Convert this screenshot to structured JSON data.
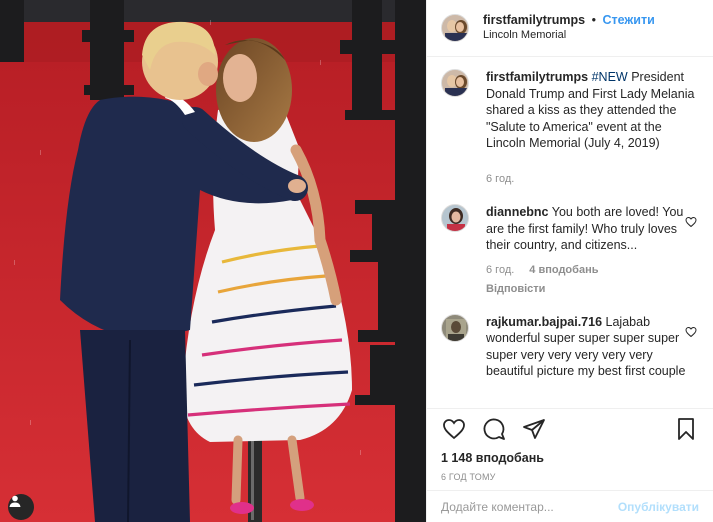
{
  "header": {
    "username": "firstfamilytrumps",
    "separator": "•",
    "follow_label": "Стежити",
    "location": "Lincoln Memorial"
  },
  "caption": {
    "username": "firstfamilytrumps",
    "hashtag": "#NEW",
    "text": "President Donald Trump and First Lady Melania shared a kiss as they attended the \"Salute to America\" event at the Lincoln Memorial (July 4, 2019)",
    "time": "6 год."
  },
  "comments": [
    {
      "username": "diannebnc",
      "text": "You both are loved! You are the first family! Who truly loves their country, and citizens...",
      "time": "6 год.",
      "likes": "4 вподобань",
      "reply_label": "Відповісти"
    },
    {
      "username": "rajkumar.bajpai.716",
      "text": "Lajabab wonderful super super super super super very very very very very beautiful picture my best first couple"
    }
  ],
  "likes_count": "1 148 вподобань",
  "timestamp": "6 ГОД ТОМУ",
  "add_comment": {
    "placeholder": "Додайте коментар...",
    "publish_label": "Опублікувати"
  },
  "icons": {
    "like": "heart-icon",
    "comment": "comment-bubble-icon",
    "share": "send-icon",
    "save": "bookmark-icon",
    "photo_account": "user-account-icon"
  },
  "colors": {
    "link_blue": "#3897f0",
    "hashtag": "#003569",
    "muted": "#8e8e8e",
    "publish_disabled": "#b2dffc",
    "carpet_red": "#c8242b"
  }
}
